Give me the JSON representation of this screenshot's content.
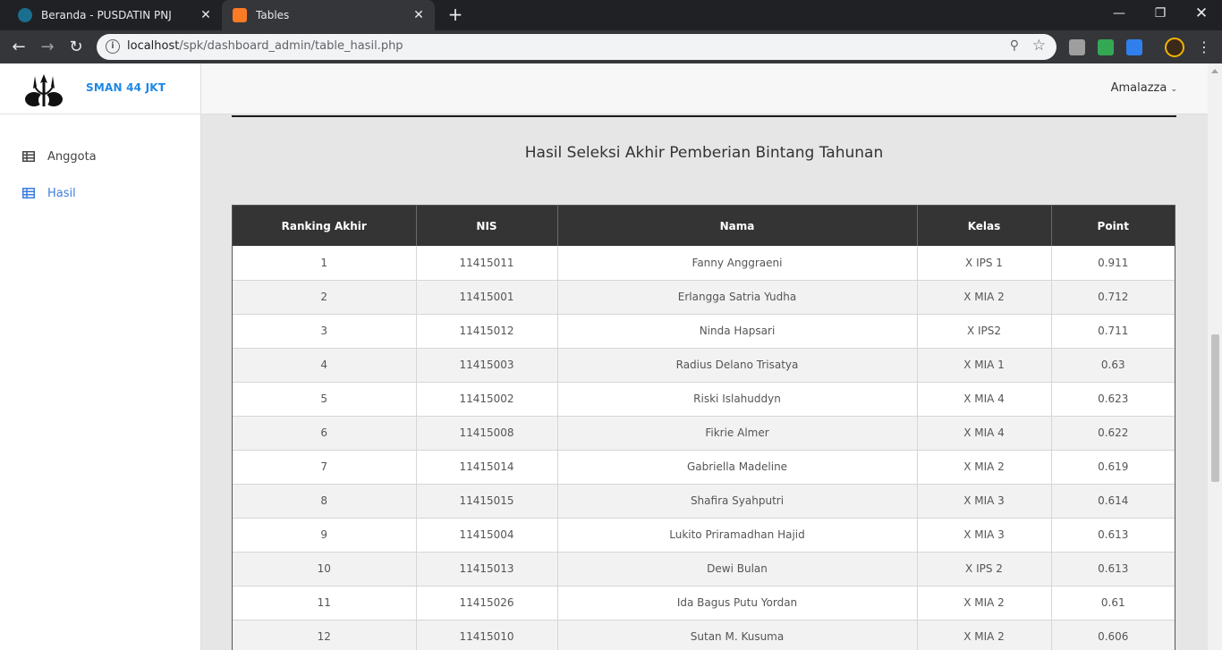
{
  "browser": {
    "tabs": [
      {
        "title": "Beranda - PUSDATIN PNJ",
        "active": false
      },
      {
        "title": "Tables",
        "active": true
      }
    ],
    "url_host": "localhost",
    "url_path": "/spk/dashboard_admin/table_hasil.php"
  },
  "sidebar": {
    "brand": "SMAN 44 JKT",
    "items": [
      {
        "label": "Anggota",
        "active": false
      },
      {
        "label": "Hasil",
        "active": true
      }
    ]
  },
  "topbar": {
    "user": "Amalazza"
  },
  "main": {
    "heading": "Hasil Seleksi Akhir Pemberian Bintang Tahunan",
    "table": {
      "columns": [
        "Ranking Akhir",
        "NIS",
        "Nama",
        "Kelas",
        "Point"
      ],
      "rows": [
        [
          "1",
          "11415011",
          "Fanny Anggraeni",
          "X IPS 1",
          "0.911"
        ],
        [
          "2",
          "11415001",
          "Erlangga Satria Yudha",
          "X MIA 2",
          "0.712"
        ],
        [
          "3",
          "11415012",
          "Ninda Hapsari",
          "X IPS2",
          "0.711"
        ],
        [
          "4",
          "11415003",
          "Radius Delano Trisatya",
          "X MIA 1",
          "0.63"
        ],
        [
          "5",
          "11415002",
          "Riski Islahuddyn",
          "X MIA 4",
          "0.623"
        ],
        [
          "6",
          "11415008",
          "Fikrie Almer",
          "X MIA 4",
          "0.622"
        ],
        [
          "7",
          "11415014",
          "Gabriella Madeline",
          "X MIA 2",
          "0.619"
        ],
        [
          "8",
          "11415015",
          "Shafira Syahputri",
          "X MIA 3",
          "0.614"
        ],
        [
          "9",
          "11415004",
          "Lukito Priramadhan Hajid",
          "X MIA 3",
          "0.613"
        ],
        [
          "10",
          "11415013",
          "Dewi Bulan",
          "X IPS 2",
          "0.613"
        ],
        [
          "11",
          "11415026",
          "Ida Bagus Putu Yordan",
          "X MIA 2",
          "0.61"
        ],
        [
          "12",
          "11415010",
          "Sutan M. Kusuma",
          "X MIA 2",
          "0.606"
        ]
      ]
    }
  },
  "colors": {
    "accent": "#3b7ddd",
    "brand": "#1e88e5",
    "table_header": "#343434"
  }
}
